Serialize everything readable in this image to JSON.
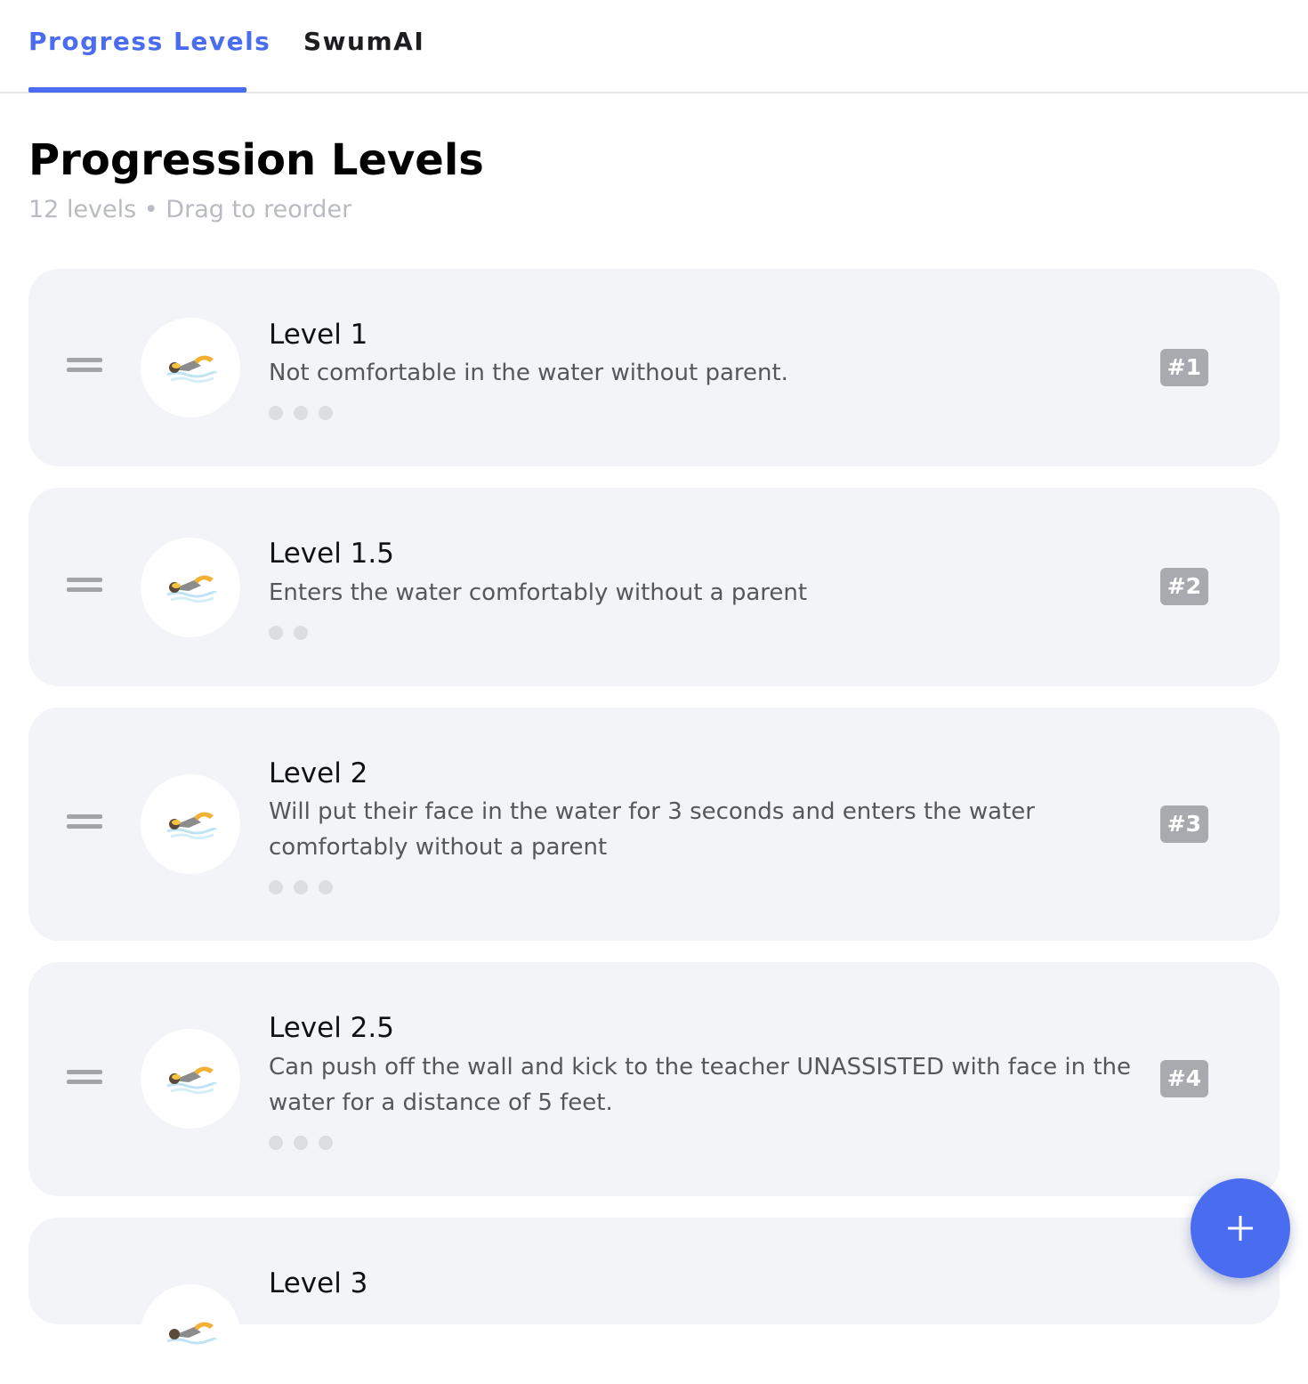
{
  "tabs": [
    {
      "label": "Progress Levels",
      "active": true
    },
    {
      "label": "SwumAI",
      "active": false
    }
  ],
  "header": {
    "title": "Progression Levels",
    "subtitle": "12 levels • Drag to reorder"
  },
  "levels": [
    {
      "name": "Level 1",
      "description": "Not comfortable in the water without parent.",
      "badge": "#1",
      "dots": 3,
      "icon": "swimmer-icon"
    },
    {
      "name": "Level 1.5",
      "description": "Enters the water comfortably without a parent",
      "badge": "#2",
      "dots": 2,
      "icon": "swimmer-icon"
    },
    {
      "name": "Level 2",
      "description": "Will put their face in the water for 3 seconds and enters the water comfortably without a parent",
      "badge": "#3",
      "dots": 3,
      "icon": "swimmer-icon"
    },
    {
      "name": "Level 2.5",
      "description": "Can push off the wall and kick to the teacher UNASSISTED with face in the water for a distance of 5 feet.",
      "badge": "#4",
      "dots": 3,
      "icon": "swimmer-icon"
    },
    {
      "name": "Level 3",
      "icon": "swimmer-icon"
    }
  ],
  "fab": {
    "icon": "plus-icon"
  },
  "colors": {
    "accent": "#4a6cf0",
    "card_background": "#f3f4f7",
    "badge": "#a8aaaf"
  }
}
